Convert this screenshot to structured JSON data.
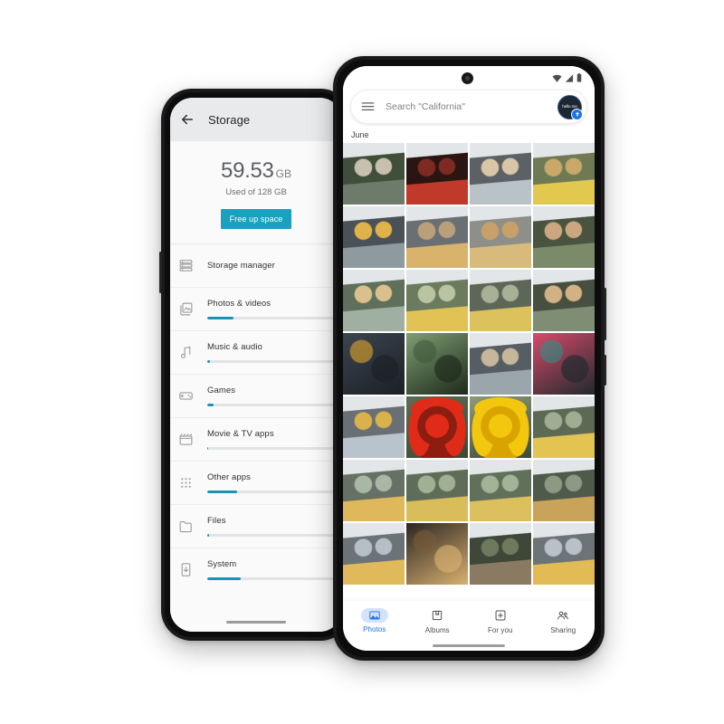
{
  "scene": {
    "background": "#ffffff",
    "accent_teal": "#1ca0bf",
    "accent_blue": "#1a73e8"
  },
  "storage_phone": {
    "appbar": {
      "back_icon": "back-arrow-icon",
      "title": "Storage"
    },
    "usage": {
      "amount": "59.53",
      "unit": "GB",
      "subtitle": "Used of 128 GB",
      "button_label": "Free up space"
    },
    "rows": [
      {
        "icon": "storage-manager-icon",
        "label": "Storage manager",
        "bar": false,
        "percent": 0
      },
      {
        "icon": "photos-videos-icon",
        "label": "Photos & videos",
        "bar": true,
        "percent": 20
      },
      {
        "icon": "music-audio-icon",
        "label": "Music & audio",
        "bar": true,
        "percent": 2
      },
      {
        "icon": "games-icon",
        "label": "Games",
        "bar": true,
        "percent": 5
      },
      {
        "icon": "movie-tv-apps-icon",
        "label": "Movie & TV apps",
        "bar": true,
        "percent": 0.6
      },
      {
        "icon": "other-apps-icon",
        "label": "Other apps",
        "bar": true,
        "percent": 23
      },
      {
        "icon": "files-icon",
        "label": "Files",
        "bar": true,
        "percent": 1.2
      },
      {
        "icon": "system-icon",
        "label": "System",
        "bar": true,
        "percent": 26
      }
    ]
  },
  "photos_phone": {
    "statusbar": {
      "wifi_icon": "wifi-icon",
      "signal_icon": "signal-icon",
      "battery_icon": "battery-icon"
    },
    "search": {
      "menu_icon": "hamburger-menu-icon",
      "placeholder": "Search \"California\"",
      "avatar_text": "hello mo",
      "avatar_badge_icon": "upload-arrow-icon"
    },
    "month_header": "June",
    "grid": {
      "columns": 4,
      "cells": [
        {
          "name": "photo-two-men-smiling",
          "kind": "people",
          "a": "#6e7a6a",
          "b": "#c8bfae",
          "c": "#3f4f3a"
        },
        {
          "name": "photo-couple-red-light",
          "kind": "people",
          "a": "#c0392b",
          "b": "#7e2a23",
          "c": "#2a1512"
        },
        {
          "name": "photo-couple-city-smiling",
          "kind": "people",
          "a": "#b9c2c6",
          "b": "#d8c6a6",
          "c": "#5c6166"
        },
        {
          "name": "photo-group-selfie-yellow",
          "kind": "people",
          "a": "#e2c84f",
          "b": "#c9a86a",
          "c": "#6f7a55"
        },
        {
          "name": "photo-man-peace-sign",
          "kind": "people",
          "a": "#8d9aa0",
          "b": "#e0b24a",
          "c": "#4a5257"
        },
        {
          "name": "photo-woman-curly-yellow",
          "kind": "people",
          "a": "#d9b36b",
          "b": "#b9a07a",
          "c": "#6a6f74"
        },
        {
          "name": "photo-woman-curly-hand-hair",
          "kind": "people",
          "a": "#d8ba7d",
          "b": "#c7a06a",
          "c": "#8d8f88"
        },
        {
          "name": "photo-couple-green-shirt",
          "kind": "people",
          "a": "#7b8b6a",
          "b": "#caa77f",
          "c": "#49533f"
        },
        {
          "name": "photo-piggyback-park",
          "kind": "people",
          "a": "#9fb0a2",
          "b": "#d9c08c",
          "c": "#5f6f5a"
        },
        {
          "name": "photo-couple-yellow-park",
          "kind": "people",
          "a": "#e0c255",
          "b": "#b9c5a2",
          "c": "#6c7a5d"
        },
        {
          "name": "photo-friends-yellow-street",
          "kind": "people",
          "a": "#dcc25c",
          "b": "#a8b096",
          "c": "#5d6757"
        },
        {
          "name": "photo-man-woman-embrace",
          "kind": "people",
          "a": "#7f8d74",
          "b": "#d2b183",
          "c": "#474f40"
        },
        {
          "name": "photo-city-lanterns-night",
          "kind": "scene",
          "a": "#e2a72a",
          "b": "#3b4450",
          "c": "#1b2026"
        },
        {
          "name": "photo-water-droplets-leaves",
          "kind": "scene",
          "a": "#3f5a3a",
          "b": "#7f9e72",
          "c": "#1d2a1b"
        },
        {
          "name": "photo-three-friends-city",
          "kind": "people",
          "a": "#9aa6ac",
          "b": "#c6b79b",
          "c": "#565e63"
        },
        {
          "name": "photo-person-red-teal-back",
          "kind": "scene",
          "a": "#2f8f85",
          "b": "#d84a6a",
          "c": "#1e2a2d"
        },
        {
          "name": "photo-skater-city",
          "kind": "people",
          "a": "#b9c3cb",
          "b": "#d9b24a",
          "c": "#6a6f75"
        },
        {
          "name": "photo-red-lily-flower",
          "kind": "flower",
          "a": "#e02b18",
          "b": "#8d1d10",
          "c": "#5b6d52"
        },
        {
          "name": "photo-yellow-lily-flower",
          "kind": "flower",
          "a": "#f2c70d",
          "b": "#d9a400",
          "c": "#8e9a7a"
        },
        {
          "name": "photo-couple-yellow-garden",
          "kind": "people",
          "a": "#e3c452",
          "b": "#9fae93",
          "c": "#5c6a55"
        },
        {
          "name": "photo-couple-hug-skyline",
          "kind": "people",
          "a": "#e0b85c",
          "b": "#a9b8a4",
          "c": "#667065"
        },
        {
          "name": "photo-friends-lift-park",
          "kind": "people",
          "a": "#d9bd5a",
          "b": "#9fb095",
          "c": "#5f6d58"
        },
        {
          "name": "photo-friends-lift-park-two",
          "kind": "people",
          "a": "#dcc05e",
          "b": "#a2b397",
          "c": "#61705a"
        },
        {
          "name": "photo-friends-table-drinks",
          "kind": "people",
          "a": "#caa35a",
          "b": "#8c9a84",
          "c": "#4f5a4b"
        },
        {
          "name": "photo-man-yellow-skyline",
          "kind": "people",
          "a": "#e0b95a",
          "b": "#b4c0c6",
          "c": "#6b7377"
        },
        {
          "name": "photo-woman-night-bokeh",
          "kind": "scene",
          "a": "#7a5a3a",
          "b": "#2b2622",
          "c": "#d8b070"
        },
        {
          "name": "photo-man-portrait-park",
          "kind": "people",
          "a": "#8a7a62",
          "b": "#6d7a5e",
          "c": "#3f4738"
        },
        {
          "name": "photo-man-yellow-bridge",
          "kind": "people",
          "a": "#e2bb55",
          "b": "#b9c1c6",
          "c": "#6d7478"
        }
      ]
    },
    "bottom_nav": [
      {
        "icon": "photos-icon",
        "label": "Photos",
        "active": true
      },
      {
        "icon": "albums-icon",
        "label": "Albums",
        "active": false
      },
      {
        "icon": "for-you-icon",
        "label": "For you",
        "active": false
      },
      {
        "icon": "sharing-icon",
        "label": "Sharing",
        "active": false
      }
    ]
  }
}
